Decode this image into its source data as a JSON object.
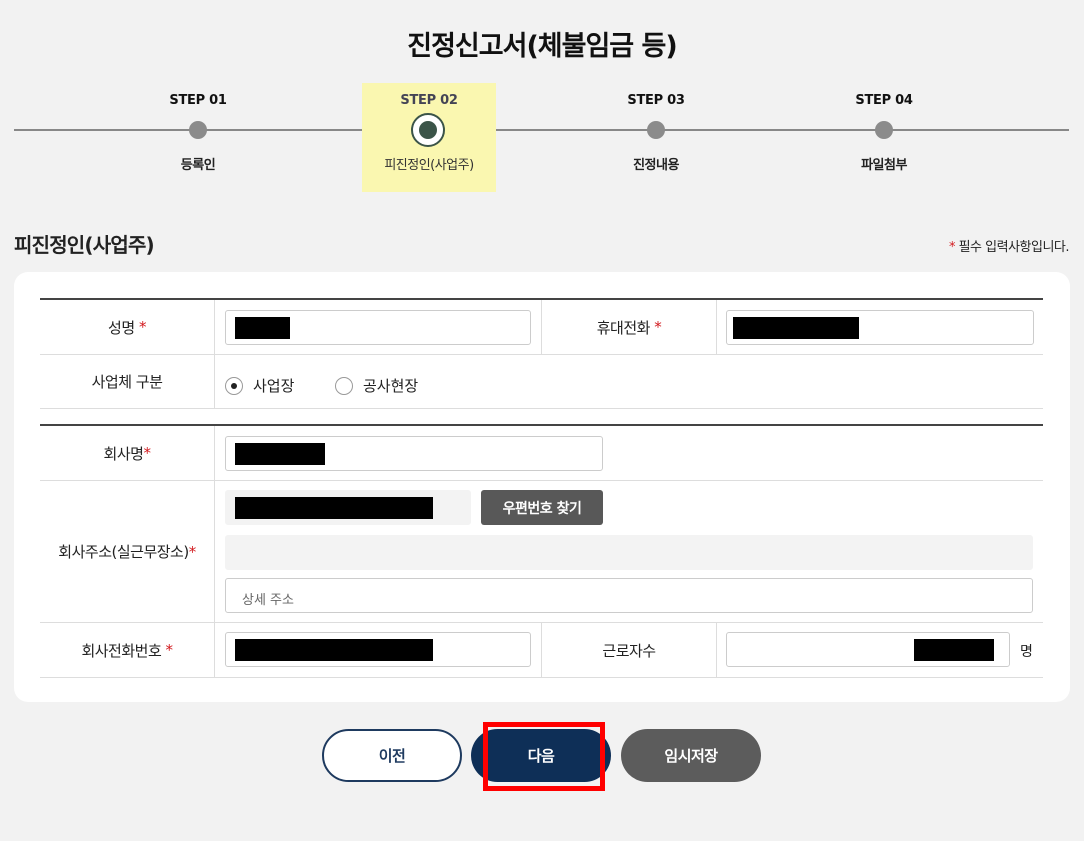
{
  "page": {
    "title": "진정신고서(체불임금 등)"
  },
  "stepper": {
    "steps": [
      {
        "num": "STEP 01",
        "label": "등록인",
        "active": false
      },
      {
        "num": "STEP 02",
        "label": "피진정인(사업주)",
        "active": true
      },
      {
        "num": "STEP 03",
        "label": "진정내용",
        "active": false
      },
      {
        "num": "STEP 04",
        "label": "파일첨부",
        "active": false
      }
    ]
  },
  "section": {
    "title": "피진정인(사업주)",
    "required_mark": "*",
    "required_note": "필수 입력사항입니다."
  },
  "form": {
    "name_label": "성명",
    "mobile_label": "휴대전화",
    "business_type_label": "사업체 구분",
    "business_type_options": [
      "사업장",
      "공사현장"
    ],
    "business_type_selected": "사업장",
    "company_name_label": "회사명",
    "company_address_label": "회사주소(실근무장소)",
    "zip_search_button": "우편번호 찾기",
    "detail_address_placeholder": "상세 주소",
    "company_phone_label": "회사전화번호",
    "workers_label": "근로자수",
    "workers_unit": "명",
    "req": "*"
  },
  "buttons": {
    "prev": "이전",
    "next": "다음",
    "save": "임시저장"
  },
  "colors": {
    "primary": "#0e2f57",
    "active_step_bg": "#faf7b0",
    "required": "#d2191e",
    "highlight": "#ff0000"
  }
}
